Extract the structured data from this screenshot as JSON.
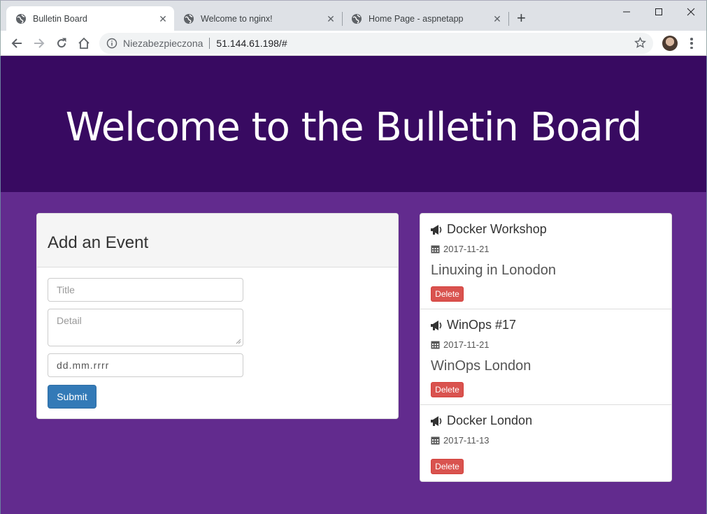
{
  "browser": {
    "tabs": [
      {
        "title": "Bulletin Board",
        "active": true
      },
      {
        "title": "Welcome to nginx!",
        "active": false
      },
      {
        "title": "Home Page - aspnetapp",
        "active": false
      }
    ],
    "address": {
      "security": "Niezabezpieczona",
      "url": "51.144.61.198/#"
    }
  },
  "page": {
    "heading": "Welcome to the Bulletin Board",
    "add_event": {
      "title": "Add an Event",
      "title_placeholder": "Title",
      "detail_placeholder": "Detail",
      "date_value": "dd.mm.rrrr",
      "submit_label": "Submit"
    },
    "events": [
      {
        "title": "Docker Workshop",
        "date": "2017-11-21",
        "detail": "Linuxing in Lonodon",
        "delete_label": "Delete"
      },
      {
        "title": "WinOps #17",
        "date": "2017-11-21",
        "detail": "WinOps London",
        "delete_label": "Delete"
      },
      {
        "title": "Docker London",
        "date": "2017-11-13",
        "detail": "",
        "delete_label": "Delete"
      }
    ]
  },
  "colors": {
    "jumbotron": "#380a61",
    "page_bg": "#622b8e",
    "submit": "#337ab7",
    "delete": "#d9534f"
  }
}
